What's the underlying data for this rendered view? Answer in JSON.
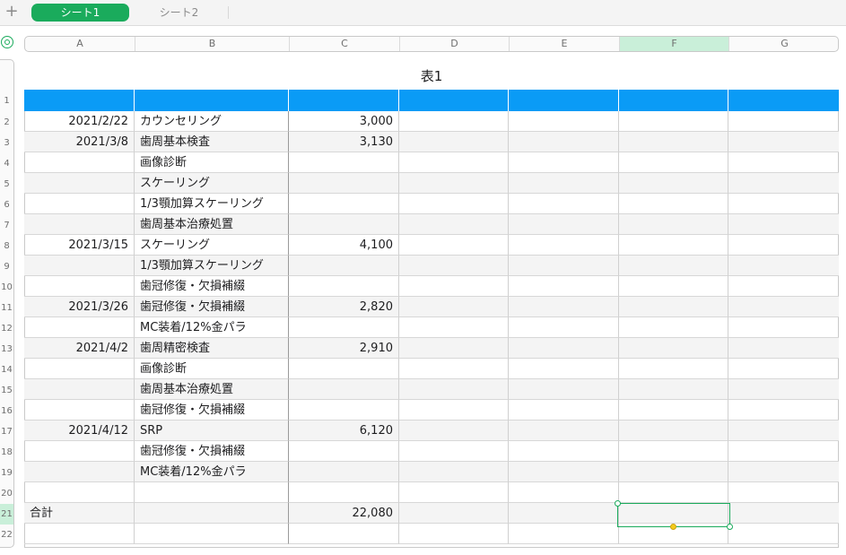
{
  "tabs": {
    "add_label": "+",
    "active": "シート1",
    "inactive": "シート2"
  },
  "table": {
    "title": "表1"
  },
  "columns": [
    "A",
    "B",
    "C",
    "D",
    "E",
    "F",
    "G"
  ],
  "selected_column": "F",
  "selected_row": "21",
  "rows": [
    {
      "num": "1",
      "a": "",
      "b": "",
      "c": ""
    },
    {
      "num": "2",
      "a": "2021/2/22",
      "b": "カウンセリング",
      "c": "3,000"
    },
    {
      "num": "3",
      "a": "2021/3/8",
      "b": "歯周基本検査",
      "c": "3,130"
    },
    {
      "num": "4",
      "a": "",
      "b": "画像診断",
      "c": ""
    },
    {
      "num": "5",
      "a": "",
      "b": "スケーリング",
      "c": ""
    },
    {
      "num": "6",
      "a": "",
      "b": "1/3顎加算スケーリング",
      "c": ""
    },
    {
      "num": "7",
      "a": "",
      "b": "歯周基本治療処置",
      "c": ""
    },
    {
      "num": "8",
      "a": "2021/3/15",
      "b": "スケーリング",
      "c": "4,100"
    },
    {
      "num": "9",
      "a": "",
      "b": "1/3顎加算スケーリング",
      "c": ""
    },
    {
      "num": "10",
      "a": "",
      "b": "歯冠修復・欠損補綴",
      "c": ""
    },
    {
      "num": "11",
      "a": "2021/3/26",
      "b": "歯冠修復・欠損補綴",
      "c": "2,820"
    },
    {
      "num": "12",
      "a": "",
      "b": "MC装着/12%金パラ",
      "c": ""
    },
    {
      "num": "13",
      "a": "2021/4/2",
      "b": "歯周精密検査",
      "c": "2,910"
    },
    {
      "num": "14",
      "a": "",
      "b": "画像診断",
      "c": ""
    },
    {
      "num": "15",
      "a": "",
      "b": "歯周基本治療処置",
      "c": ""
    },
    {
      "num": "16",
      "a": "",
      "b": "歯冠修復・欠損補綴",
      "c": ""
    },
    {
      "num": "17",
      "a": "2021/4/12",
      "b": "SRP",
      "c": "6,120"
    },
    {
      "num": "18",
      "a": "",
      "b": "歯冠修復・欠損補綴",
      "c": ""
    },
    {
      "num": "19",
      "a": "",
      "b": "MC装着/12%金パラ",
      "c": ""
    },
    {
      "num": "20",
      "a": "",
      "b": "",
      "c": ""
    },
    {
      "num": "21",
      "a": "合計",
      "b": "",
      "c": "22,080"
    },
    {
      "num": "22",
      "a": "",
      "b": "",
      "c": ""
    }
  ],
  "colors": {
    "accent": "#1aab5c",
    "header_fill": "#0a9bf6",
    "alt_row": "#f4f4f4"
  }
}
